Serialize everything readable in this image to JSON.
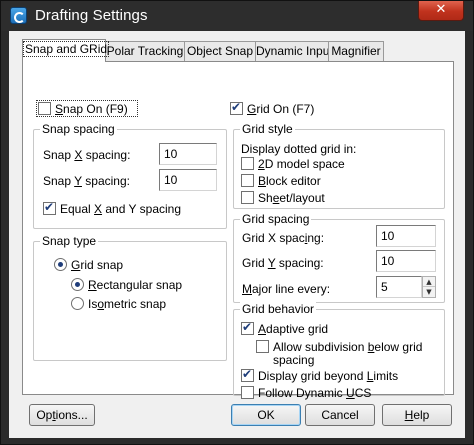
{
  "window": {
    "title": "Drafting Settings",
    "close_glyph": "✕"
  },
  "tabs": [
    {
      "label": "Snap and GRid",
      "active": true
    },
    {
      "label": "Polar Tracking"
    },
    {
      "label": "Object Snap"
    },
    {
      "label": "Dynamic Input"
    },
    {
      "label": "Magnifier"
    }
  ],
  "snap": {
    "snap_on": {
      "pre": "",
      "hot": "S",
      "post": "nap On (F9)",
      "checked": false
    },
    "spacing_group": "Snap spacing",
    "x_label": {
      "pre": "Snap ",
      "hot": "X",
      "post": " spacing:"
    },
    "x_value": "10",
    "y_label": {
      "pre": "Snap ",
      "hot": "Y",
      "post": " spacing:"
    },
    "y_value": "10",
    "equal": {
      "pre": "Equal ",
      "hot": "X",
      "post": " and Y spacing",
      "checked": true
    },
    "type_group": "Snap type",
    "grid_snap": {
      "pre": "",
      "hot": "G",
      "post": "rid snap",
      "selected": true
    },
    "rectangular": {
      "pre": "",
      "hot": "R",
      "post": "ectangular snap",
      "selected": true
    },
    "isometric": {
      "pre": "Is",
      "hot": "o",
      "post": "metric snap",
      "selected": false
    }
  },
  "grid": {
    "grid_on": {
      "pre": "",
      "hot": "G",
      "post": "rid On (F7)",
      "checked": true
    },
    "style_group": "Grid style",
    "dotted_in": "Display dotted grid in:",
    "model": {
      "pre": "",
      "hot": "2",
      "post": "D model space",
      "checked": false
    },
    "block": {
      "pre": "",
      "hot": "B",
      "post": "lock editor",
      "checked": false
    },
    "sheet": {
      "pre": "Sh",
      "hot": "e",
      "post": "et/layout",
      "checked": false
    },
    "spacing_group": "Grid spacing",
    "x_label": {
      "pre": "Grid X spac",
      "hot": "i",
      "post": "ng:"
    },
    "x_value": "10",
    "y_label": {
      "pre": "Grid ",
      "hot": "Y",
      "post": " spacing:"
    },
    "y_value": "10",
    "major_label": {
      "pre": "",
      "hot": "M",
      "post": "ajor line every:"
    },
    "major_value": "5",
    "behavior_group": "Grid behavior",
    "adaptive": {
      "pre": "",
      "hot": "A",
      "post": "daptive grid",
      "checked": true
    },
    "subdivision_line1": {
      "pre": "Allow subdivision ",
      "hot": "b",
      "post": "elow grid"
    },
    "subdivision_line2": "spacing",
    "subdivision_checked": false,
    "beyond": {
      "pre": "Display grid beyond ",
      "hot": "L",
      "post": "imits",
      "checked": true
    },
    "follow": {
      "pre": "Follow Dynamic ",
      "hot": "U",
      "post": "CS",
      "checked": false
    }
  },
  "buttons": {
    "options": {
      "pre": "Op",
      "hot": "t",
      "post": "ions..."
    },
    "ok": "OK",
    "cancel": "Cancel",
    "help": {
      "pre": "",
      "hot": "H",
      "post": "elp"
    }
  },
  "icons": {
    "spin_up": "▲",
    "spin_down": "▼"
  }
}
